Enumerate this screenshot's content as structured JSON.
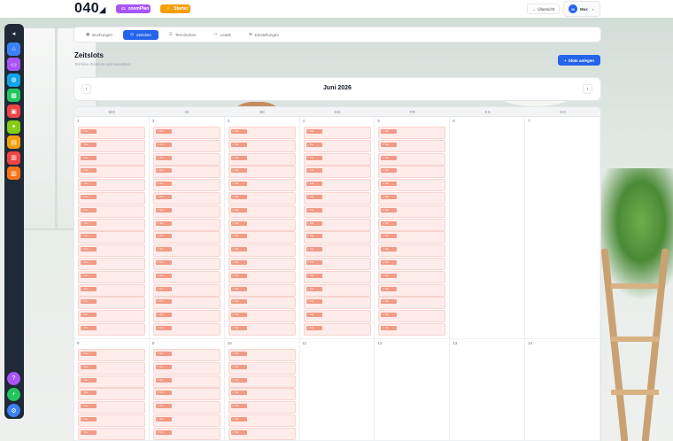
{
  "header": {
    "logo": "040",
    "zoom_badge": "zoomPlan",
    "plan_badge": "Starter",
    "overview_button": "Übersicht",
    "user": {
      "initials": "M",
      "name": "Max"
    }
  },
  "dock": {
    "items": [
      {
        "icon": "collapse-icon",
        "color": "#1f2937"
      },
      {
        "icon": "home-icon",
        "color": "#3b82f6"
      },
      {
        "icon": "video-icon",
        "color": "#a855f7"
      },
      {
        "icon": "globe-icon",
        "color": "#0ea5e9"
      },
      {
        "icon": "calendar-icon",
        "color": "#22c55e"
      },
      {
        "icon": "calendar-check-icon",
        "color": "#ef4444"
      },
      {
        "icon": "star-icon",
        "color": "#84cc16"
      },
      {
        "icon": "calendar-days-icon",
        "color": "#f59e0b"
      },
      {
        "icon": "calendar-event-icon",
        "color": "#ef4444"
      },
      {
        "icon": "calendar-week-icon",
        "color": "#f97316"
      }
    ],
    "bottom": [
      {
        "icon": "help-icon",
        "color": "#a855f7"
      },
      {
        "icon": "plus-icon",
        "color": "#22c55e"
      },
      {
        "icon": "settings-icon",
        "color": "#3b82f6"
      }
    ]
  },
  "tabs": [
    {
      "label": "Buchungen",
      "icon": "calendar-icon",
      "active": false
    },
    {
      "label": "Zeitslots",
      "icon": "clock-icon",
      "active": true
    },
    {
      "label": "Terminarten",
      "icon": "list-icon",
      "active": false
    },
    {
      "label": "Leads",
      "icon": "user-icon",
      "active": false
    },
    {
      "label": "Einstellungen",
      "icon": "gear-icon",
      "active": false
    }
  ],
  "page": {
    "title": "Zeitslots",
    "subtitle": "Termine-Zeitslots und verwalten",
    "add_button": "Slots anlegen"
  },
  "calendar": {
    "month": "Juni 2026",
    "weekdays": [
      "MO",
      "DI",
      "MI",
      "DO",
      "FR",
      "SA",
      "SO"
    ],
    "weeks": [
      {
        "days": [
          {
            "num": "1",
            "slots": 16
          },
          {
            "num": "2",
            "slots": 16
          },
          {
            "num": "3",
            "slots": 16
          },
          {
            "num": "4",
            "slots": 16
          },
          {
            "num": "5",
            "slots": 16
          },
          {
            "num": "6",
            "slots": 0
          },
          {
            "num": "7",
            "slots": 0
          }
        ]
      },
      {
        "days": [
          {
            "num": "8",
            "slots": 7
          },
          {
            "num": "9",
            "slots": 7
          },
          {
            "num": "10",
            "slots": 7
          },
          {
            "num": "11",
            "slots": 0
          },
          {
            "num": "12",
            "slots": 0
          },
          {
            "num": "13",
            "slots": 0
          },
          {
            "num": "14",
            "slots": 0
          }
        ]
      }
    ],
    "slot_badge": "frei",
    "slot_colors": {
      "bg": "#fdecea",
      "badge": "#f19a85"
    }
  }
}
